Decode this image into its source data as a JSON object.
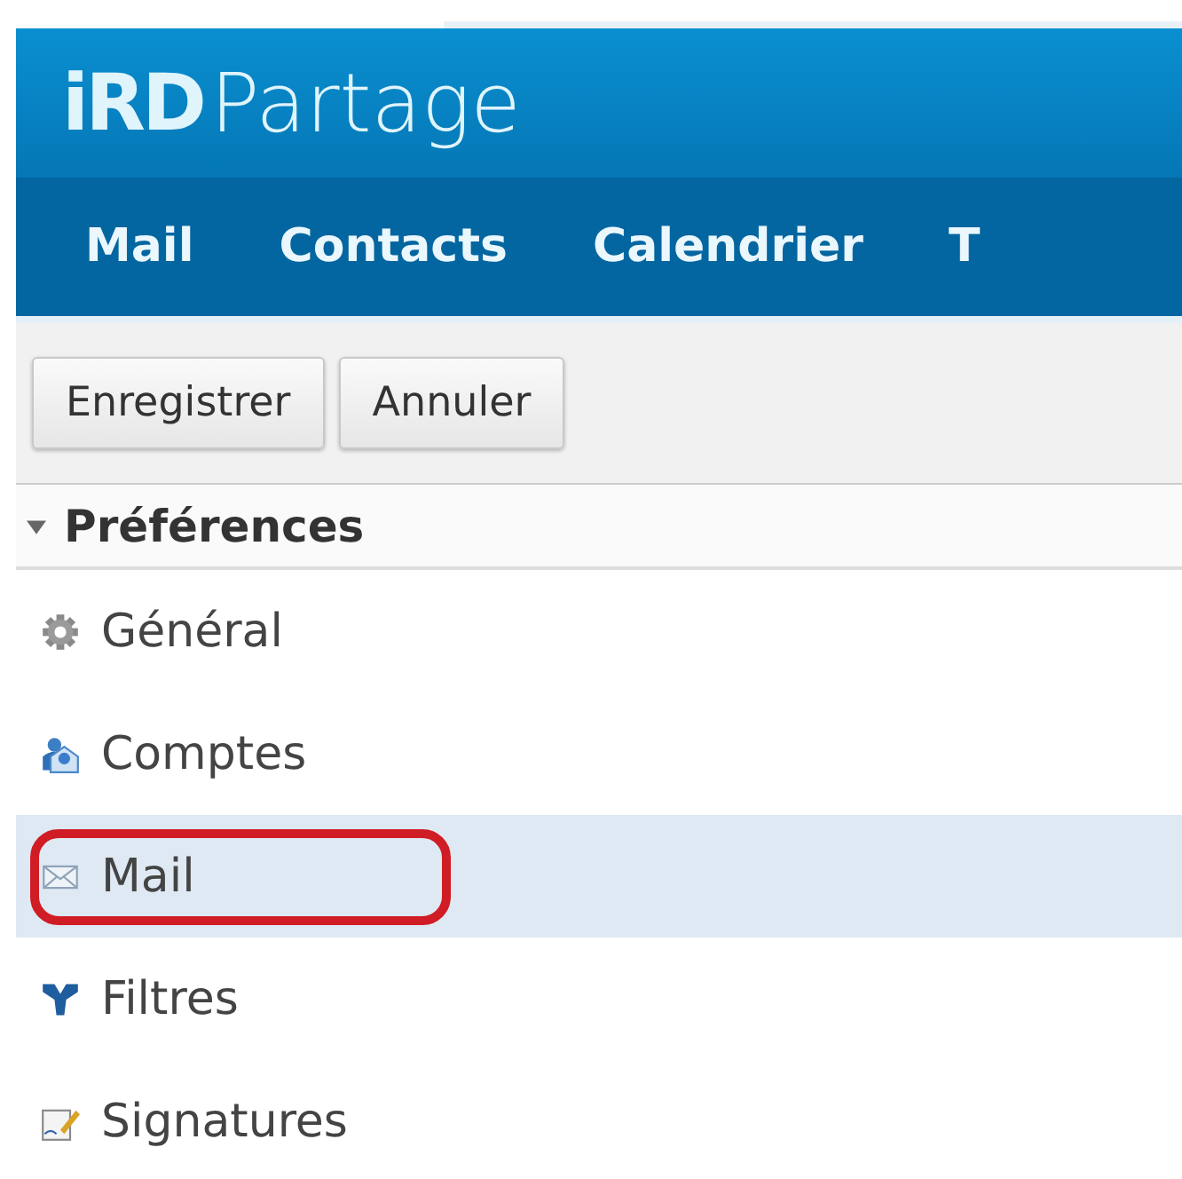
{
  "brand": {
    "mark": "iRD",
    "name": "Partage"
  },
  "nav": [
    {
      "label": "Mail"
    },
    {
      "label": "Contacts"
    },
    {
      "label": "Calendrier"
    },
    {
      "label": "T"
    }
  ],
  "toolbar": {
    "buttons": [
      "Enregistrer",
      "Annuler"
    ]
  },
  "sidebar": {
    "heading": "Préférences",
    "expanded": true,
    "items": [
      {
        "label": "Général",
        "kind": "gear",
        "selected": false,
        "circled": false
      },
      {
        "label": "Comptes",
        "kind": "accounts",
        "selected": false,
        "circled": false
      },
      {
        "label": "Mail",
        "kind": "envelope",
        "selected": true,
        "circled": true
      },
      {
        "label": "Filtres",
        "kind": "filter",
        "selected": false,
        "circled": false
      },
      {
        "label": "Signatures",
        "kind": "signature",
        "selected": false,
        "circled": false
      }
    ]
  }
}
